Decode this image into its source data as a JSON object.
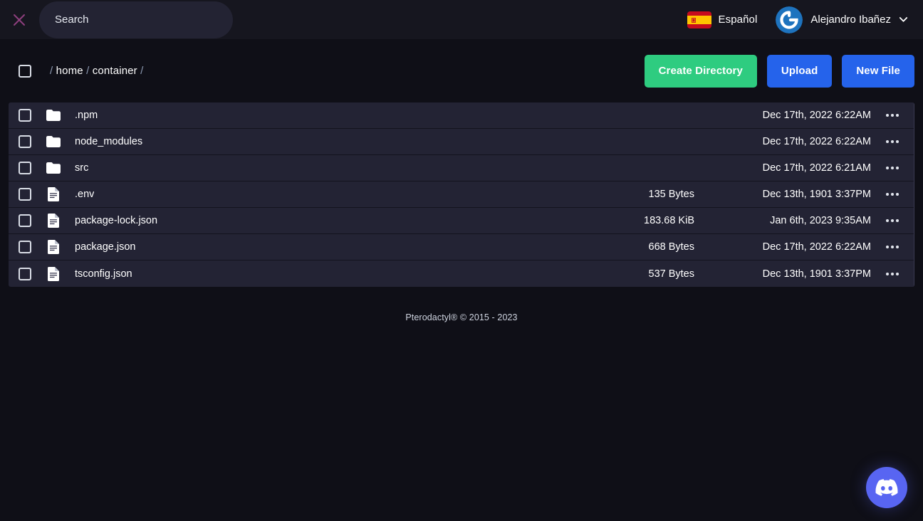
{
  "topbar": {
    "close_icon": "close-icon",
    "search": {
      "placeholder": "Search",
      "value": ""
    },
    "locale": {
      "flag_icon": "flag-spain-icon",
      "label": "Español"
    },
    "user": {
      "avatar_icon": "gravatar-logo-icon",
      "name": "Alejandro Ibañez",
      "caret_icon": "chevron-down-icon"
    }
  },
  "actionbar": {
    "select_all_checked": false,
    "breadcrumb_parts": [
      "/",
      "home",
      "/",
      "container",
      "/"
    ],
    "breadcrumb_text": "/ home / container /",
    "buttons": {
      "create_directory": "Create Directory",
      "upload": "Upload",
      "new_file": "New File"
    }
  },
  "files": [
    {
      "name": ".npm",
      "type": "directory",
      "icon": "folder-icon",
      "size": "",
      "date": "Dec 17th, 2022 6:22AM"
    },
    {
      "name": "node_modules",
      "type": "directory",
      "icon": "folder-icon",
      "size": "",
      "date": "Dec 17th, 2022 6:22AM"
    },
    {
      "name": "src",
      "type": "directory",
      "icon": "folder-icon",
      "size": "",
      "date": "Dec 17th, 2022 6:21AM"
    },
    {
      "name": ".env",
      "type": "file",
      "icon": "document-icon",
      "size": "135 Bytes",
      "date": "Dec 13th, 1901 3:37PM"
    },
    {
      "name": "package-lock.json",
      "type": "file",
      "icon": "document-icon",
      "size": "183.68 KiB",
      "date": "Jan 6th, 2023 9:35AM"
    },
    {
      "name": "package.json",
      "type": "file",
      "icon": "document-icon",
      "size": "668 Bytes",
      "date": "Dec 17th, 2022 6:22AM"
    },
    {
      "name": "tsconfig.json",
      "type": "file",
      "icon": "document-icon",
      "size": "537 Bytes",
      "date": "Dec 13th, 1901 3:37PM"
    }
  ],
  "row_menu_icon": "ellipsis-icon",
  "footer": {
    "text": "Pterodactyl® © 2015 - 2023"
  },
  "fab": {
    "icon": "discord-icon",
    "label": "Discord"
  },
  "colors": {
    "page_bg": "#0f0f17",
    "topbar_bg": "#16161f",
    "row_bg": "#232334",
    "row_divider": "#13131d",
    "green": "#2ecc80",
    "blue": "#2563eb",
    "close_icon": "#8e3f7e",
    "discord": "#5865f2",
    "gravatar": "#1e73be"
  }
}
